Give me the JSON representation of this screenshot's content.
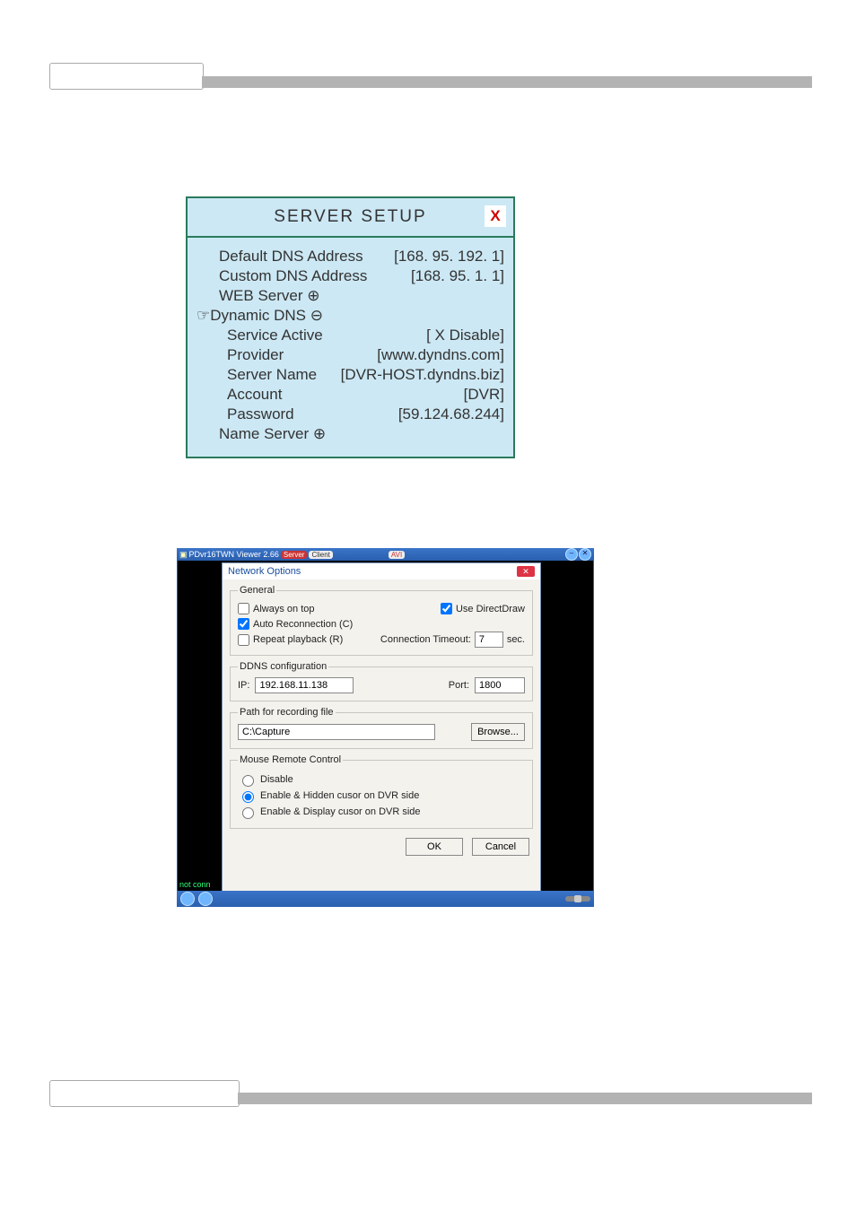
{
  "server": {
    "title": "SERVER SETUP",
    "rows": {
      "default_dns_label": "Default DNS Address",
      "default_dns_value": "[168. 95. 192.  1]",
      "custom_dns_label": "Custom DNS Address",
      "custom_dns_value": "[168. 95.   1.   1]",
      "web_server_label": "WEB Server ⊕",
      "dynamic_dns_label": "☞Dynamic DNS ⊖",
      "service_active_label": "Service Active",
      "service_active_value": "[ X Disable]",
      "provider_label": "Provider",
      "provider_value": "[www.dyndns.com]",
      "server_name_label": "Server Name",
      "server_name_value": "[DVR-HOST.dyndns.biz]",
      "account_label": "Account",
      "account_value": "[DVR]",
      "password_label": "Password",
      "password_value": "[59.124.68.244]",
      "name_server_label": "Name Server ⊕"
    }
  },
  "app": {
    "title": "PDvr16TWN Viewer 2.66",
    "pill_server": "Server",
    "pill_client": "Client",
    "pill_avi": "AVI",
    "not_connected": "not conn"
  },
  "dialog": {
    "title": "Network Options",
    "general": {
      "legend": "General",
      "always_on_top": "Always on top",
      "use_directdraw": "Use DirectDraw",
      "auto_reconnection": "Auto Reconnection (C)",
      "repeat_playback": "Repeat playback (R)",
      "connection_timeout_label": "Connection Timeout:",
      "connection_timeout_value": "7",
      "connection_timeout_unit": "sec."
    },
    "ddns": {
      "legend": "DDNS configuration",
      "ip_label": "IP:",
      "ip_value": "192.168.11.138",
      "port_label": "Port:",
      "port_value": "1800"
    },
    "path": {
      "legend": "Path for recording file",
      "value": "C:\\Capture",
      "browse": "Browse..."
    },
    "mouse": {
      "legend": "Mouse Remote Control",
      "opt_disable": "Disable",
      "opt_hidden": "Enable & Hidden cusor on DVR side",
      "opt_display": "Enable & Display cusor on DVR side"
    },
    "ok": "OK",
    "cancel": "Cancel"
  }
}
